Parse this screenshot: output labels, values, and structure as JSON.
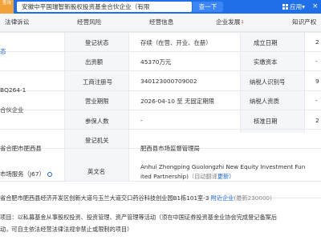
{
  "header": {
    "badge": "查询",
    "search_value": "安徽中平国瑞智新股权投资基金合伙企业（有限",
    "search_button": "查一下",
    "apps_label": "应用",
    "apps_dropdown": "▾",
    "close": "×"
  },
  "tabs": [
    {
      "label": "法律诉讼"
    },
    {
      "label": "经营风险"
    },
    {
      "label": "经营信息"
    },
    {
      "label": "企业发展",
      "sup": "1"
    },
    {
      "label": "知识产权"
    }
  ],
  "left_column": {
    "row1": "态",
    "row3": "BQ264-1",
    "row5": "合伙企业",
    "row8": "省合肥市肥西县",
    "row9": "市场服务（J67）",
    "row11": "省合肥市肥西县经济开发区创新大道与玉兰大道交口药谷科技创业园B1栋101室-3"
  },
  "rows": [
    {
      "label": "登记状态",
      "value": "存续（在营、开业、在册）",
      "label2": "成立日期",
      "value2": "2"
    },
    {
      "label": "出资额",
      "value": "45370万元",
      "label2": "实缴资本",
      "value2": "-"
    },
    {
      "label": "工商注册号",
      "value": "340123000709002",
      "label2": "纳税人识别号",
      "value2": "9"
    },
    {
      "label": "营业期限",
      "value": "2026-04-10 至 无固定期限",
      "label2": "纳税人资质",
      "value2": "-"
    },
    {
      "label": "参保人数",
      "value": "-",
      "label2": "核准日期",
      "value2": "2"
    },
    {
      "label": "登记机关",
      "value": "肥西县市场监督管理局"
    },
    {
      "label": "英文名",
      "value_line1": "Anhui Zhongping Guolongzhi New Equity Investment Fun",
      "value_line2": "ited Partnership)",
      "translate": "（自动翻译",
      "update": "更新）"
    }
  ],
  "address_extra": {
    "nearby": "附近企业",
    "radar": "(最新230000)"
  },
  "scope": {
    "line1": "项目：以私募基金从事股权投资、投资管理、资产管理等活动（须在中国证券投资基金业协会完成登记备案后",
    "line2": "动，可自主依法经营法律法规非禁止或限制的项目）"
  },
  "colors": {
    "topbar": "#1f6fe8",
    "badge": "#f2a23a",
    "link": "#1a66d6",
    "label_bg": "#f4f6f9"
  }
}
